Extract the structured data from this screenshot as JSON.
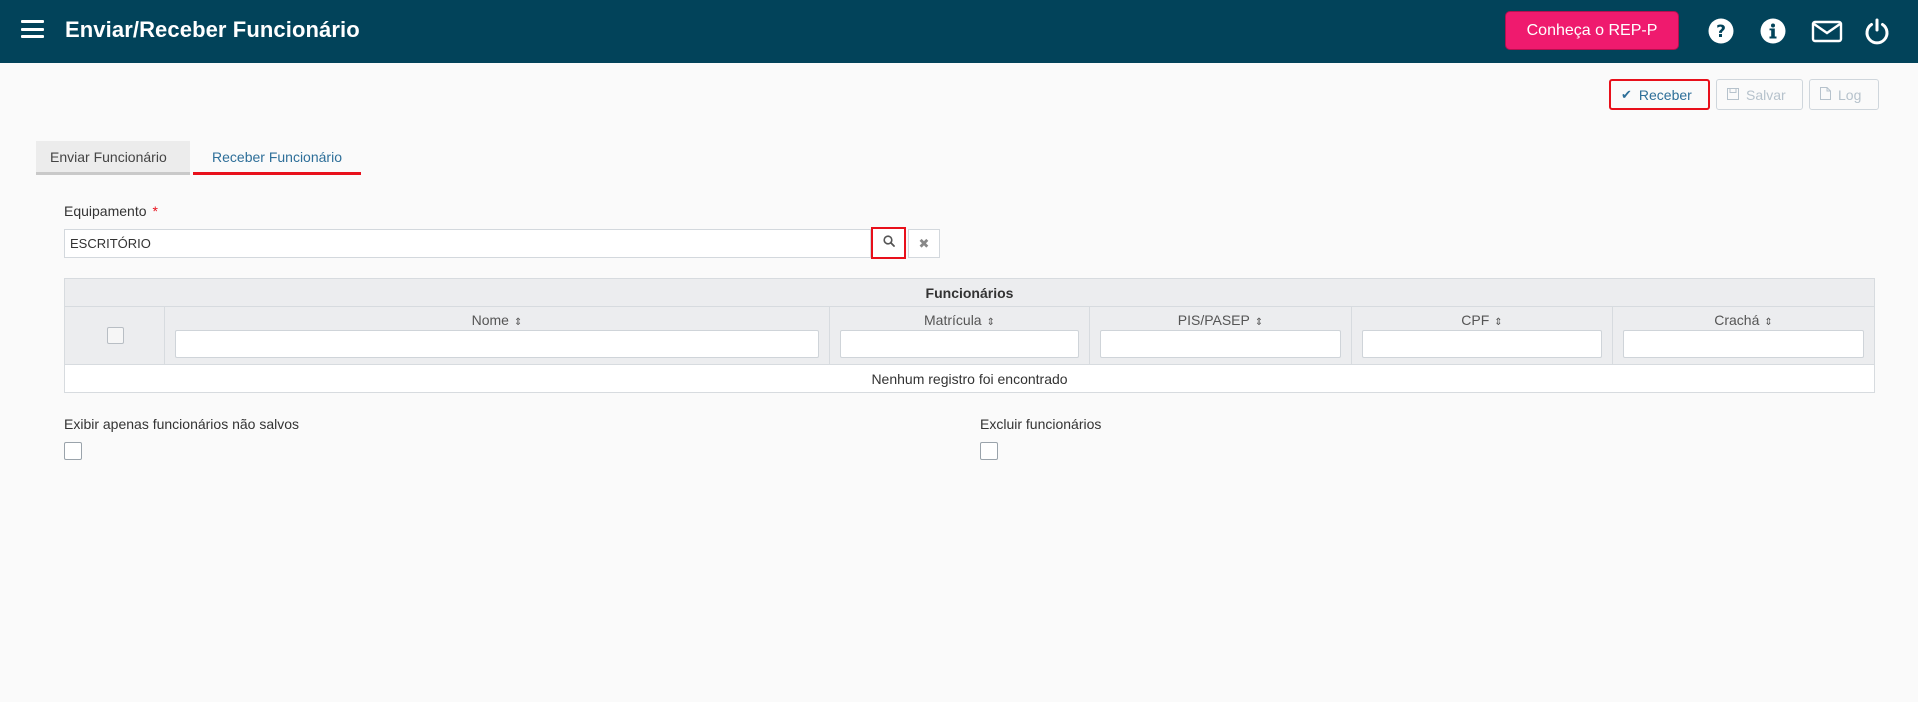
{
  "header": {
    "title": "Enviar/Receber Funcionário",
    "promo_button": "Conheça o REP-P",
    "icons": [
      "help-icon",
      "info-icon",
      "mail-icon",
      "power-icon"
    ]
  },
  "toolbar": {
    "receber_label": "Receber",
    "salvar_label": "Salvar",
    "log_label": "Log"
  },
  "tabs": [
    {
      "label": "Enviar Funcionário",
      "active": false
    },
    {
      "label": "Receber Funcionário",
      "active": true
    }
  ],
  "equipamento": {
    "label": "Equipamento",
    "required_mark": "*",
    "value": "ESCRITÓRIO"
  },
  "table": {
    "caption": "Funcionários",
    "columns": [
      "Nome",
      "Matrícula",
      "PIS/PASEP",
      "CPF",
      "Crachá"
    ],
    "empty_message": "Nenhum registro foi encontrado"
  },
  "options": {
    "only_unsaved_label": "Exibir apenas funcionários não salvos",
    "delete_label": "Excluir funcionários"
  },
  "colors": {
    "topbar": "#02435a",
    "promo": "#ef1a6e",
    "accent": "#2e6f99",
    "highlight": "#e8101b"
  }
}
